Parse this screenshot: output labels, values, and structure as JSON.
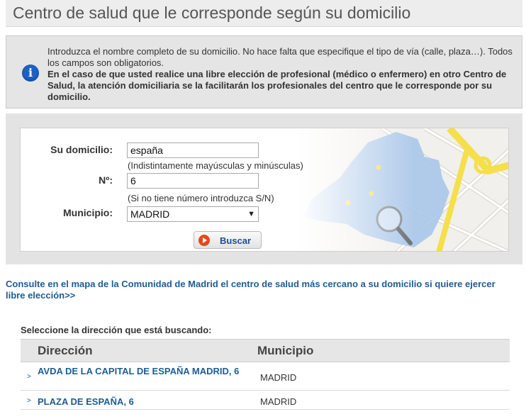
{
  "page": {
    "title": "Centro de salud que le corresponde según su domicilio"
  },
  "info": {
    "line_normal": "Introduzca el nombre completo de su domicilio. No hace falta que especifique el tipo de vía (calle, plaza…). Todos los campos son obligatorios.",
    "line_bold": "En el caso de que usted realice una libre elección de profesional (médico o enfermero) en otro Centro de Salud, la atención domiciliaria se la facilitarán los profesionales del centro que le corresponde por su domicilio."
  },
  "form": {
    "domicilio_label": "Su domicilio:",
    "domicilio_value": "españa",
    "domicilio_hint": "(Indistintamente mayúsculas y minúsculas)",
    "numero_label": "Nº:",
    "numero_value": "6",
    "numero_hint": "(Si no tiene número introduzca S/N)",
    "municipio_label": "Municipio:",
    "municipio_value": "MADRID",
    "search_label": "Buscar"
  },
  "map_link": "Consulte en el mapa de la Comunidad de Madrid el centro de salud más cercano a su domicilio si quiere ejercer libre elección>>",
  "results": {
    "label": "Seleccione la dirección que está buscando:",
    "headers": {
      "direccion": "Dirección",
      "municipio": "Municipio"
    },
    "rows": [
      {
        "arrow": ">",
        "direccion": "AVDA DE LA CAPITAL DE ESPAÑA MADRID, 6",
        "municipio": "MADRID"
      },
      {
        "arrow": ">",
        "direccion": "PLAZA DE ESPAÑA, 6",
        "municipio": "MADRID"
      }
    ]
  },
  "colors": {
    "link": "#1d5c95",
    "info_icon": "#1c62c6",
    "map_region": "#a9c6ea",
    "map_dots": "#f3e05a"
  }
}
